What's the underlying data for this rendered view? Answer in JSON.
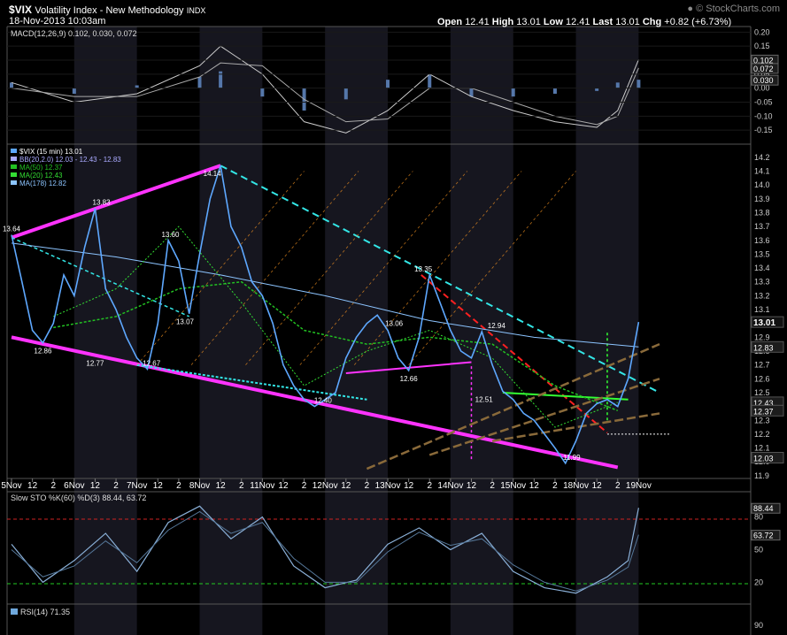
{
  "header": {
    "symbol": "$VIX",
    "name": "Volatility Index - New Methodology",
    "exchange": "INDX",
    "date": "18-Nov-2013 10:03am",
    "open_label": "Open",
    "open": "12.41",
    "high_label": "High",
    "high": "13.01",
    "low_label": "Low",
    "low": "12.41",
    "last_label": "Last",
    "last": "13.01",
    "chg_label": "Chg",
    "chg": "+0.82 (+6.73%)",
    "watermark": "© StockCharts.com",
    "watermark_icon": "up-arrow-icon"
  },
  "colors": {
    "magenta": "#ff33ff",
    "cyan": "#33e6e6",
    "red": "#ff2020",
    "green": "#33ff33",
    "price": "#5ea8ff",
    "ma178": "#8cc4ff",
    "ma50": "#22c022",
    "ma20": "#33dd33",
    "fan": "#ff9922",
    "brown": "#8a6a3a"
  },
  "chart_data": [
    {
      "type": "line",
      "title": "$VIX (15 min) 13.01",
      "legend": [
        "$VIX (15 min) 13.01",
        "BB(20,2.0) 12.03 - 12.43 - 12.83",
        "MA(50) 12.37",
        "MA(20) 12.43",
        "MA(178) 12.82"
      ],
      "legend_placement": "top-left",
      "x_ticks": [
        "5Nov",
        "12",
        "2",
        "6Nov",
        "12",
        "2",
        "7Nov",
        "12",
        "2",
        "8Nov",
        "12",
        "2",
        "11Nov",
        "12",
        "2",
        "12Nov",
        "12",
        "2",
        "13Nov",
        "12",
        "2",
        "14Nov",
        "12",
        "2",
        "15Nov",
        "12",
        "2",
        "18Nov",
        "12",
        "2",
        "19Nov"
      ],
      "y_ticks": [
        "14.2",
        "14.1",
        "14.0",
        "13.9",
        "13.8",
        "13.7",
        "13.6",
        "13.5",
        "13.4",
        "13.3",
        "13.2",
        "13.1",
        "13.0",
        "12.9",
        "12.8",
        "12.7",
        "12.6",
        "12.5",
        "12.4",
        "12.3",
        "12.2",
        "12.1",
        "12.0",
        "11.9"
      ],
      "ylim": [
        11.88,
        14.25
      ],
      "right_labels": [
        "13.01",
        "12.83",
        "12.43",
        "12.37",
        "12.03"
      ],
      "annotations": [
        {
          "text": "13.64",
          "x": 0.0,
          "y": 13.64
        },
        {
          "text": "12.86",
          "x": 1.5,
          "y": 12.86
        },
        {
          "text": "13.83",
          "x": 4.3,
          "y": 13.83
        },
        {
          "text": "12.77",
          "x": 4.0,
          "y": 12.77
        },
        {
          "text": "13.60",
          "x": 7.6,
          "y": 13.6
        },
        {
          "text": "13.07",
          "x": 8.3,
          "y": 13.07
        },
        {
          "text": "12.67",
          "x": 6.7,
          "y": 12.67
        },
        {
          "text": "14.14",
          "x": 9.6,
          "y": 14.14
        },
        {
          "text": "12.40",
          "x": 14.9,
          "y": 12.4
        },
        {
          "text": "13.06",
          "x": 18.3,
          "y": 13.06
        },
        {
          "text": "13.35",
          "x": 19.7,
          "y": 13.35
        },
        {
          "text": "12.66",
          "x": 19.0,
          "y": 12.66
        },
        {
          "text": "12.94",
          "x": 23.2,
          "y": 12.94
        },
        {
          "text": "12.51",
          "x": 22.6,
          "y": 12.51
        },
        {
          "text": "11.99",
          "x": 26.8,
          "y": 11.99
        }
      ],
      "series": [
        {
          "name": "$VIX (15 min)",
          "x": [
            0,
            0.5,
            1,
            1.5,
            2,
            2.5,
            3,
            3.5,
            4,
            4.5,
            5,
            5.5,
            6,
            6.5,
            7,
            7.5,
            8,
            8.5,
            9,
            9.5,
            10,
            10.5,
            11,
            11.5,
            12,
            12.5,
            13,
            13.5,
            14,
            14.5,
            15,
            15.5,
            16,
            16.5,
            17,
            17.5,
            18,
            18.5,
            19,
            19.5,
            20,
            20.5,
            21,
            21.5,
            22,
            22.5,
            23,
            23.5,
            24,
            24.5,
            25,
            25.5,
            26,
            26.5,
            27,
            27.5,
            28,
            28.5,
            29,
            29.5,
            30
          ],
          "y": [
            13.64,
            13.3,
            12.95,
            12.86,
            13.0,
            13.35,
            13.2,
            13.55,
            13.83,
            13.25,
            13.1,
            12.9,
            12.75,
            12.67,
            13.0,
            13.6,
            13.45,
            13.07,
            13.5,
            13.9,
            14.14,
            13.7,
            13.55,
            13.3,
            13.2,
            13.0,
            12.7,
            12.55,
            12.45,
            12.4,
            12.45,
            12.5,
            12.75,
            12.9,
            13.0,
            13.06,
            12.95,
            12.75,
            12.66,
            12.9,
            13.35,
            13.15,
            12.95,
            12.8,
            12.75,
            12.94,
            12.7,
            12.51,
            12.45,
            12.35,
            12.3,
            12.2,
            12.1,
            11.99,
            12.15,
            12.35,
            12.42,
            12.45,
            12.4,
            12.6,
            13.01
          ]
        },
        {
          "name": "MA(178)",
          "x": [
            0,
            5,
            10,
            15,
            20,
            25,
            30
          ],
          "y": [
            13.58,
            13.48,
            13.35,
            13.2,
            13.02,
            12.9,
            12.83
          ]
        },
        {
          "name": "MA(50)",
          "x": [
            2,
            5,
            8,
            11,
            14,
            17,
            20,
            23,
            26,
            29
          ],
          "y": [
            12.97,
            13.05,
            13.25,
            13.3,
            12.95,
            12.85,
            12.9,
            12.85,
            12.55,
            12.37
          ]
        },
        {
          "name": "MA(20)",
          "x": [
            2,
            5,
            8,
            11,
            14,
            17,
            20,
            23,
            26,
            29
          ],
          "y": [
            13.05,
            13.25,
            13.7,
            13.15,
            12.55,
            12.8,
            12.95,
            12.75,
            12.25,
            12.43
          ]
        }
      ]
    },
    {
      "type": "line",
      "title": "MACD(12,26,9) 0.102, 0.030, 0.072",
      "y_ticks": [
        "0.20",
        "0.15",
        "0.10",
        "0.05",
        "0.00",
        "-0.05",
        "-0.10",
        "-0.15"
      ],
      "ylim": [
        -0.2,
        0.22
      ],
      "right_labels": [
        "0.102",
        "0.072",
        "0.030"
      ],
      "series": [
        {
          "name": "MACD",
          "x": [
            0,
            3,
            6,
            9,
            10,
            12,
            14,
            16,
            18,
            20,
            22,
            24,
            26,
            28,
            29,
            30
          ],
          "y": [
            0.02,
            -0.05,
            -0.02,
            0.08,
            0.15,
            0.05,
            -0.12,
            -0.16,
            -0.08,
            0.05,
            -0.03,
            -0.08,
            -0.12,
            -0.14,
            -0.08,
            0.102
          ]
        },
        {
          "name": "Signal",
          "x": [
            0,
            3,
            6,
            9,
            10,
            12,
            14,
            16,
            18,
            20,
            22,
            24,
            26,
            28,
            29,
            30
          ],
          "y": [
            0.0,
            -0.03,
            -0.03,
            0.04,
            0.09,
            0.08,
            -0.04,
            -0.12,
            -0.11,
            0.0,
            0.0,
            -0.05,
            -0.1,
            -0.13,
            -0.1,
            0.072
          ]
        }
      ]
    },
    {
      "type": "line",
      "title": "Slow STO %K(60) %D(3) 88.44, 63.72",
      "y_ticks": [
        "80",
        "50",
        "20"
      ],
      "ylim": [
        0,
        100
      ],
      "right_labels": [
        "88.44",
        "63.72"
      ],
      "series": [
        {
          "name": "%K",
          "x": [
            0,
            1.5,
            3,
            4.5,
            6,
            7.5,
            9,
            10.5,
            12,
            13.5,
            15,
            16.5,
            18,
            19.5,
            21,
            22.5,
            24,
            25.5,
            27,
            28.5,
            29.5,
            30
          ],
          "y": [
            55,
            20,
            40,
            65,
            30,
            75,
            90,
            60,
            80,
            35,
            15,
            22,
            55,
            70,
            50,
            65,
            30,
            15,
            10,
            25,
            40,
            88.44
          ]
        },
        {
          "name": "%D",
          "x": [
            0,
            1.5,
            3,
            4.5,
            6,
            7.5,
            9,
            10.5,
            12,
            13.5,
            15,
            16.5,
            18,
            19.5,
            21,
            22.5,
            24,
            25.5,
            27,
            28.5,
            29.5,
            30
          ],
          "y": [
            50,
            25,
            35,
            58,
            38,
            68,
            85,
            65,
            75,
            42,
            20,
            20,
            48,
            66,
            54,
            60,
            36,
            20,
            12,
            22,
            34,
            63.72
          ]
        }
      ]
    },
    {
      "type": "line",
      "title": "RSI(14) 71.35",
      "y_ticks": [
        "90"
      ]
    }
  ]
}
